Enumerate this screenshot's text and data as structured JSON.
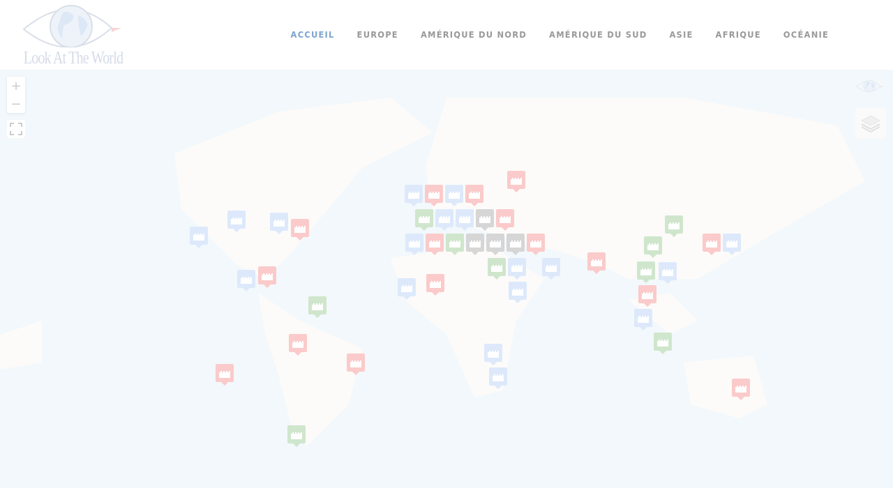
{
  "logo": {
    "text": "Look At The World"
  },
  "nav": [
    {
      "label": "ACCUEIL",
      "selected": true
    },
    {
      "label": "EUROPE",
      "selected": false
    },
    {
      "label": "AMÉRIQUE DU NORD",
      "selected": false
    },
    {
      "label": "AMÉRIQUE DU SUD",
      "selected": false
    },
    {
      "label": "ASIE",
      "selected": false
    },
    {
      "label": "AFRIQUE",
      "selected": false
    },
    {
      "label": "OCÉANIE",
      "selected": false
    }
  ],
  "map": {
    "kind": "picture",
    "zoom_in": "+",
    "zoom_out": "−",
    "markers": [
      {
        "color": "#fbcaca"
      },
      {
        "color": "#fbcaca"
      },
      {
        "color": "#fbcaca"
      },
      {
        "color": "#fbcaca"
      },
      {
        "color": "#fbcaca"
      },
      {
        "color": "#fbcaca"
      },
      {
        "color": "#fbcaca"
      },
      {
        "color": "#fbcaca"
      },
      {
        "color": "#fbcaca"
      },
      {
        "color": "#fbcaca"
      },
      {
        "color": "#fbcaca"
      },
      {
        "color": "#fbcaca"
      },
      {
        "color": "#fbcaca"
      },
      {
        "color": "#fbcaca"
      },
      {
        "color": "#fbcaca"
      },
      {
        "color": "#fbcaca"
      },
      {
        "color": "#dde9fb"
      },
      {
        "color": "#dde9fb"
      },
      {
        "color": "#dde9fb"
      },
      {
        "color": "#dde9fb"
      },
      {
        "color": "#dde9fb"
      },
      {
        "color": "#dde9fb"
      },
      {
        "color": "#dde9fb"
      },
      {
        "color": "#dde9fb"
      },
      {
        "color": "#dde9fb"
      },
      {
        "color": "#dde9fb"
      },
      {
        "color": "#dde9fb"
      },
      {
        "color": "#dde9fb"
      },
      {
        "color": "#dde9fb"
      },
      {
        "color": "#dde9fb"
      },
      {
        "color": "#dde9fb"
      },
      {
        "color": "#dde9fb"
      },
      {
        "color": "#dde9fb"
      },
      {
        "color": "#dde9fb"
      },
      {
        "color": "#cfe6cc"
      },
      {
        "color": "#cfe6cc"
      },
      {
        "color": "#cfe6cc"
      },
      {
        "color": "#cfe6cc"
      },
      {
        "color": "#cfe6cc"
      },
      {
        "color": "#cfe6cc"
      },
      {
        "color": "#cfe6cc"
      },
      {
        "color": "#cfe6cc"
      },
      {
        "color": "#cfe6cc"
      },
      {
        "color": "#d6d6d6"
      },
      {
        "color": "#d6d6d6"
      },
      {
        "color": "#d6d6d6"
      },
      {
        "color": "#d6d6d6"
      }
    ]
  }
}
